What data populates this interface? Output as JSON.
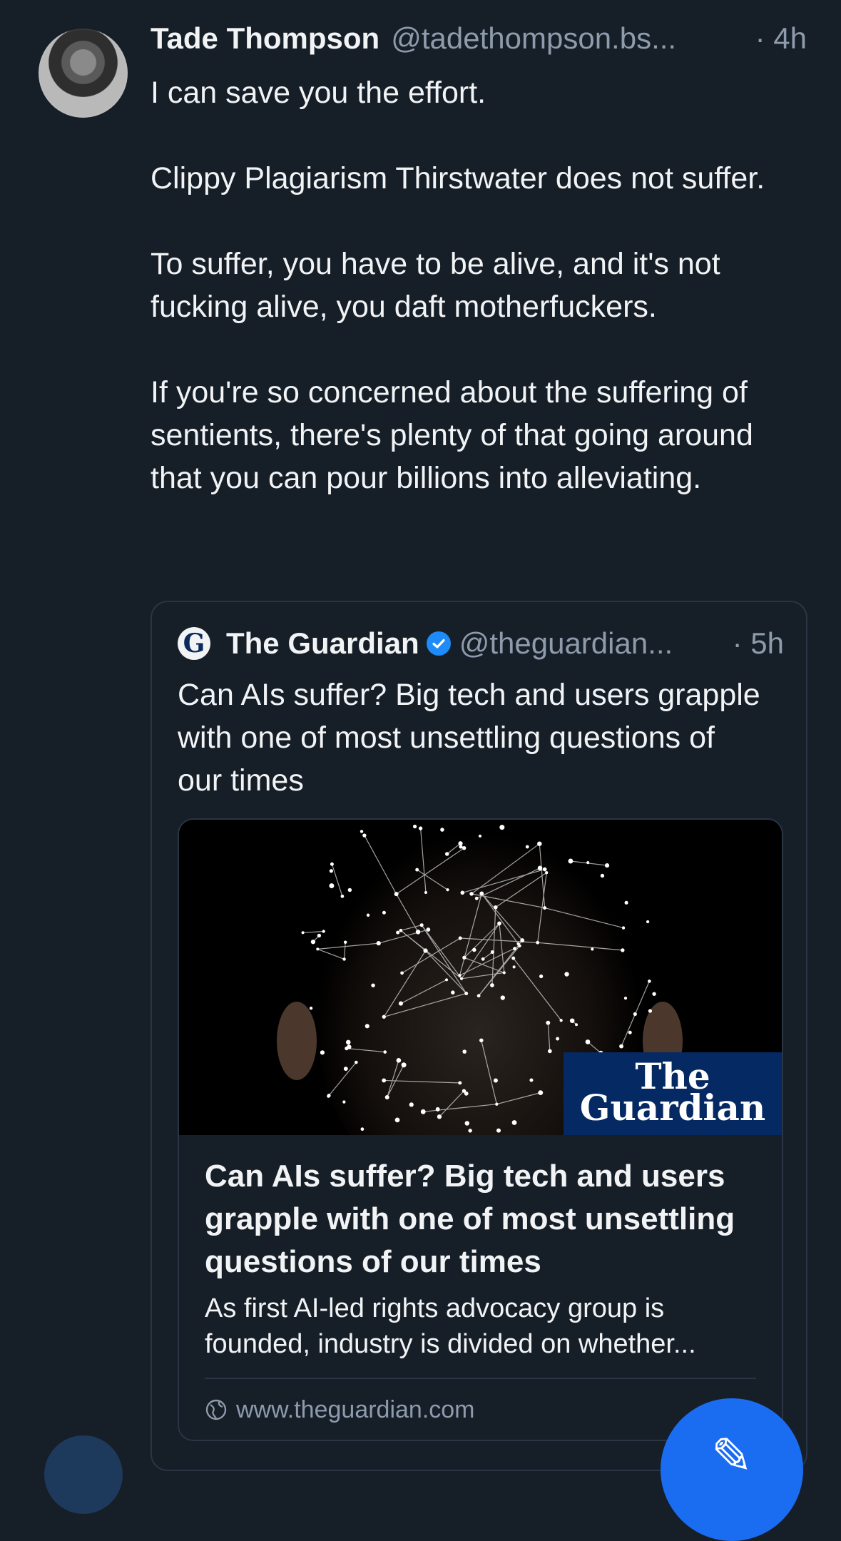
{
  "post": {
    "author_name": "Tade Thompson",
    "author_handle": "@tadethompson.bs...",
    "time": "· 4h",
    "paragraphs": [
      "I can save you the effort.",
      "Clippy Plagiarism Thirstwater does not suffer.",
      "To suffer, you have to be alive, and it's not fucking alive, you daft motherfuckers.",
      "If you're so concerned about the suffering of sentients, there's plenty of that going around that you can pour billions into alleviating."
    ]
  },
  "quote": {
    "logo_letter": "G",
    "author_name": "The Guardian",
    "author_handle": "@theguardian...",
    "time": "· 5h",
    "text": "Can AIs suffer? Big tech and users grapple with one of most unsettling questions of our times",
    "link_card": {
      "image_logo_line1": "The",
      "image_logo_line2": "Guardian",
      "title": "Can AIs suffer? Big tech and users grapple with one of most unsettling questions of our times",
      "description": "As first AI-led rights advocacy group is founded, industry is divided on whether...",
      "domain": "www.theguardian.com"
    }
  },
  "fab": {
    "icon": "compose-icon",
    "label": "✎"
  },
  "colors": {
    "background": "#161e27",
    "text": "#f1f3f5",
    "muted": "#8e9bad",
    "border": "#2a3543",
    "guardian_blue": "#052962",
    "accent": "#1a6cf0"
  }
}
